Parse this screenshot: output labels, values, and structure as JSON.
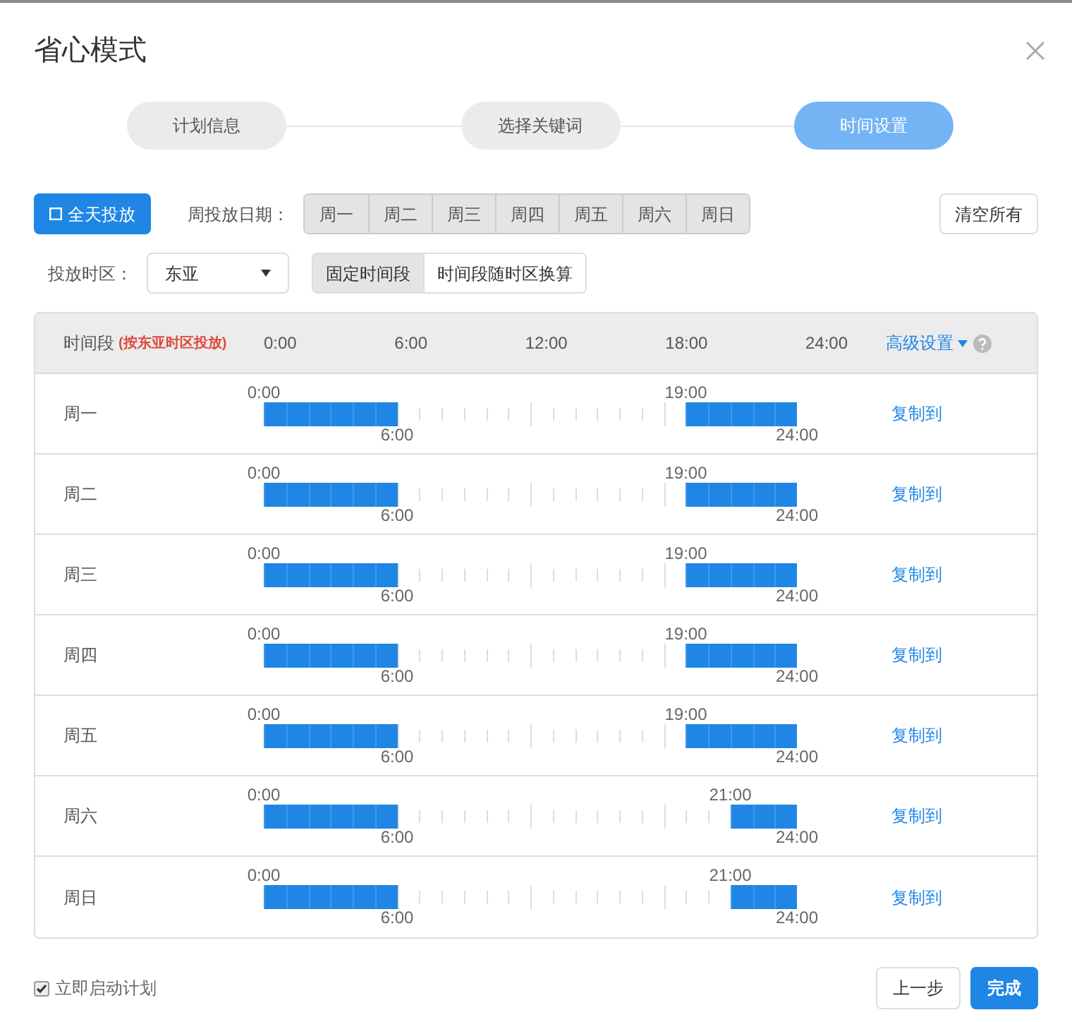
{
  "dialog": {
    "title": "省心模式"
  },
  "steps": [
    {
      "label": "计划信息",
      "selected": false
    },
    {
      "label": "选择关键词",
      "selected": false
    },
    {
      "label": "时间设置",
      "selected": true
    }
  ],
  "full_day_button": "全天投放",
  "weekday_label": "周投放日期：",
  "weekdays": [
    {
      "label": "周一",
      "selected": true
    },
    {
      "label": "周二",
      "selected": true
    },
    {
      "label": "周三",
      "selected": true
    },
    {
      "label": "周四",
      "selected": true
    },
    {
      "label": "周五",
      "selected": true
    },
    {
      "label": "周六",
      "selected": true
    },
    {
      "label": "周日",
      "selected": true
    }
  ],
  "clear_button": "清空所有",
  "timezone_label": "投放时区：",
  "timezone": {
    "value": "东亚"
  },
  "time_modes": [
    {
      "label": "固定时间段",
      "selected": true
    },
    {
      "label": "时间段随时区换算",
      "selected": false
    }
  ],
  "table": {
    "header": {
      "title": "时间段",
      "note": "(按东亚时区投放)",
      "axis": [
        "0:00",
        "6:00",
        "12:00",
        "18:00",
        "24:00"
      ],
      "advanced": "高级设置"
    },
    "rows": [
      {
        "day": "周一",
        "ranges": [
          {
            "start": "0:00",
            "end": "6:00"
          },
          {
            "start": "19:00",
            "end": "24:00"
          }
        ],
        "action": "复制到",
        "slots": [
          {
            "on": true
          },
          {
            "on": true
          },
          {
            "on": true
          },
          {
            "on": true
          },
          {
            "on": true
          },
          {
            "on": true
          },
          {
            "on": false
          },
          {
            "on": false
          },
          {
            "on": false
          },
          {
            "on": false
          },
          {
            "on": false
          },
          {
            "on": false
          },
          {
            "on": false
          },
          {
            "on": false
          },
          {
            "on": false
          },
          {
            "on": false
          },
          {
            "on": false
          },
          {
            "on": false
          },
          {
            "on": false
          },
          {
            "on": true
          },
          {
            "on": true
          },
          {
            "on": true
          },
          {
            "on": true
          },
          {
            "on": true
          }
        ]
      },
      {
        "day": "周二",
        "ranges": [
          {
            "start": "0:00",
            "end": "6:00"
          },
          {
            "start": "19:00",
            "end": "24:00"
          }
        ],
        "action": "复制到",
        "slots": [
          {
            "on": true
          },
          {
            "on": true
          },
          {
            "on": true
          },
          {
            "on": true
          },
          {
            "on": true
          },
          {
            "on": true
          },
          {
            "on": false
          },
          {
            "on": false
          },
          {
            "on": false
          },
          {
            "on": false
          },
          {
            "on": false
          },
          {
            "on": false
          },
          {
            "on": false
          },
          {
            "on": false
          },
          {
            "on": false
          },
          {
            "on": false
          },
          {
            "on": false
          },
          {
            "on": false
          },
          {
            "on": false
          },
          {
            "on": true
          },
          {
            "on": true
          },
          {
            "on": true
          },
          {
            "on": true
          },
          {
            "on": true
          }
        ]
      },
      {
        "day": "周三",
        "ranges": [
          {
            "start": "0:00",
            "end": "6:00"
          },
          {
            "start": "19:00",
            "end": "24:00"
          }
        ],
        "action": "复制到",
        "slots": [
          {
            "on": true
          },
          {
            "on": true
          },
          {
            "on": true
          },
          {
            "on": true
          },
          {
            "on": true
          },
          {
            "on": true
          },
          {
            "on": false
          },
          {
            "on": false
          },
          {
            "on": false
          },
          {
            "on": false
          },
          {
            "on": false
          },
          {
            "on": false
          },
          {
            "on": false
          },
          {
            "on": false
          },
          {
            "on": false
          },
          {
            "on": false
          },
          {
            "on": false
          },
          {
            "on": false
          },
          {
            "on": false
          },
          {
            "on": true
          },
          {
            "on": true
          },
          {
            "on": true
          },
          {
            "on": true
          },
          {
            "on": true
          }
        ]
      },
      {
        "day": "周四",
        "ranges": [
          {
            "start": "0:00",
            "end": "6:00"
          },
          {
            "start": "19:00",
            "end": "24:00"
          }
        ],
        "action": "复制到",
        "slots": [
          {
            "on": true
          },
          {
            "on": true
          },
          {
            "on": true
          },
          {
            "on": true
          },
          {
            "on": true
          },
          {
            "on": true
          },
          {
            "on": false
          },
          {
            "on": false
          },
          {
            "on": false
          },
          {
            "on": false
          },
          {
            "on": false
          },
          {
            "on": false
          },
          {
            "on": false
          },
          {
            "on": false
          },
          {
            "on": false
          },
          {
            "on": false
          },
          {
            "on": false
          },
          {
            "on": false
          },
          {
            "on": false
          },
          {
            "on": true
          },
          {
            "on": true
          },
          {
            "on": true
          },
          {
            "on": true
          },
          {
            "on": true
          }
        ]
      },
      {
        "day": "周五",
        "ranges": [
          {
            "start": "0:00",
            "end": "6:00"
          },
          {
            "start": "19:00",
            "end": "24:00"
          }
        ],
        "action": "复制到",
        "slots": [
          {
            "on": true
          },
          {
            "on": true
          },
          {
            "on": true
          },
          {
            "on": true
          },
          {
            "on": true
          },
          {
            "on": true
          },
          {
            "on": false
          },
          {
            "on": false
          },
          {
            "on": false
          },
          {
            "on": false
          },
          {
            "on": false
          },
          {
            "on": false
          },
          {
            "on": false
          },
          {
            "on": false
          },
          {
            "on": false
          },
          {
            "on": false
          },
          {
            "on": false
          },
          {
            "on": false
          },
          {
            "on": false
          },
          {
            "on": true
          },
          {
            "on": true
          },
          {
            "on": true
          },
          {
            "on": true
          },
          {
            "on": true
          }
        ]
      },
      {
        "day": "周六",
        "ranges": [
          {
            "start": "0:00",
            "end": "6:00"
          },
          {
            "start": "21:00",
            "end": "24:00"
          }
        ],
        "action": "复制到",
        "slots": [
          {
            "on": true
          },
          {
            "on": true
          },
          {
            "on": true
          },
          {
            "on": true
          },
          {
            "on": true
          },
          {
            "on": true
          },
          {
            "on": false
          },
          {
            "on": false
          },
          {
            "on": false
          },
          {
            "on": false
          },
          {
            "on": false
          },
          {
            "on": false
          },
          {
            "on": false
          },
          {
            "on": false
          },
          {
            "on": false
          },
          {
            "on": false
          },
          {
            "on": false
          },
          {
            "on": false
          },
          {
            "on": false
          },
          {
            "on": false
          },
          {
            "on": false
          },
          {
            "on": true
          },
          {
            "on": true
          },
          {
            "on": true
          }
        ]
      },
      {
        "day": "周日",
        "ranges": [
          {
            "start": "0:00",
            "end": "6:00"
          },
          {
            "start": "21:00",
            "end": "24:00"
          }
        ],
        "action": "复制到",
        "slots": [
          {
            "on": true
          },
          {
            "on": true
          },
          {
            "on": true
          },
          {
            "on": true
          },
          {
            "on": true
          },
          {
            "on": true
          },
          {
            "on": false
          },
          {
            "on": false
          },
          {
            "on": false
          },
          {
            "on": false
          },
          {
            "on": false
          },
          {
            "on": false
          },
          {
            "on": false
          },
          {
            "on": false
          },
          {
            "on": false
          },
          {
            "on": false
          },
          {
            "on": false
          },
          {
            "on": false
          },
          {
            "on": false
          },
          {
            "on": false
          },
          {
            "on": false
          },
          {
            "on": true
          },
          {
            "on": true
          },
          {
            "on": true
          }
        ]
      }
    ]
  },
  "start_now": {
    "label": "立即启动计划",
    "checked": true
  },
  "buttons": [
    {
      "label": "上一步",
      "kind": "secondary"
    },
    {
      "label": "完成",
      "kind": "primary"
    }
  ]
}
